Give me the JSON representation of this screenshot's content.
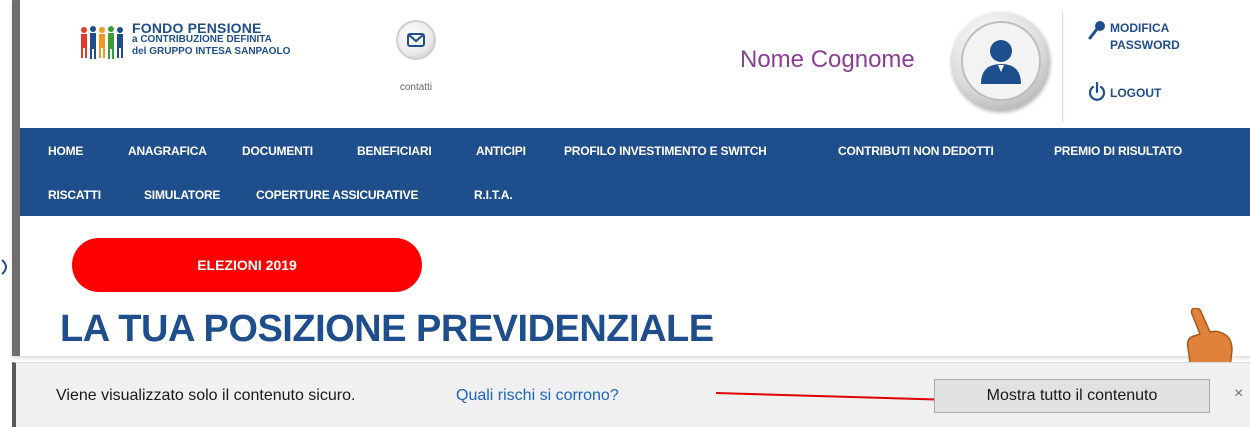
{
  "header": {
    "logo": {
      "line1": "FONDO PENSIONE",
      "line2": "a CONTRIBUZIONE DEFINITA",
      "line3": "del GRUPPO INTESA SANPAOLO"
    },
    "contact_label": "contatti",
    "user_name": "Nome Cognome",
    "modify_password_line1": "MODIFICA",
    "modify_password_line2": "PASSWORD",
    "logout_label": "LOGOUT"
  },
  "nav": {
    "row1": [
      "HOME",
      "ANAGRAFICA",
      "DOCUMENTI",
      "BENEFICIARI",
      "ANTICIPI",
      "PROFILO INVESTIMENTO E SWITCH",
      "CONTRIBUTI NON DEDOTTI",
      "PREMIO DI RISULTATO"
    ],
    "row2": [
      "RISCATTI",
      "SIMULATORE",
      "COPERTURE ASSICURATIVE",
      "R.I.T.A."
    ]
  },
  "main": {
    "elezioni_button": "ELEZIONI 2019",
    "title": "LA TUA POSIZIONE PREVIDENZIALE"
  },
  "infobar": {
    "message": "Viene visualizzato solo il contenuto sicuro.",
    "link": "Quali rischi si corrono?",
    "button": "Mostra tutto il contenuto",
    "close": "×"
  },
  "colors": {
    "brand_blue": "#1f4e8c",
    "accent_red": "#ff0000",
    "user_name_purple": "#8a3e94",
    "link_blue": "#1a65c7"
  }
}
